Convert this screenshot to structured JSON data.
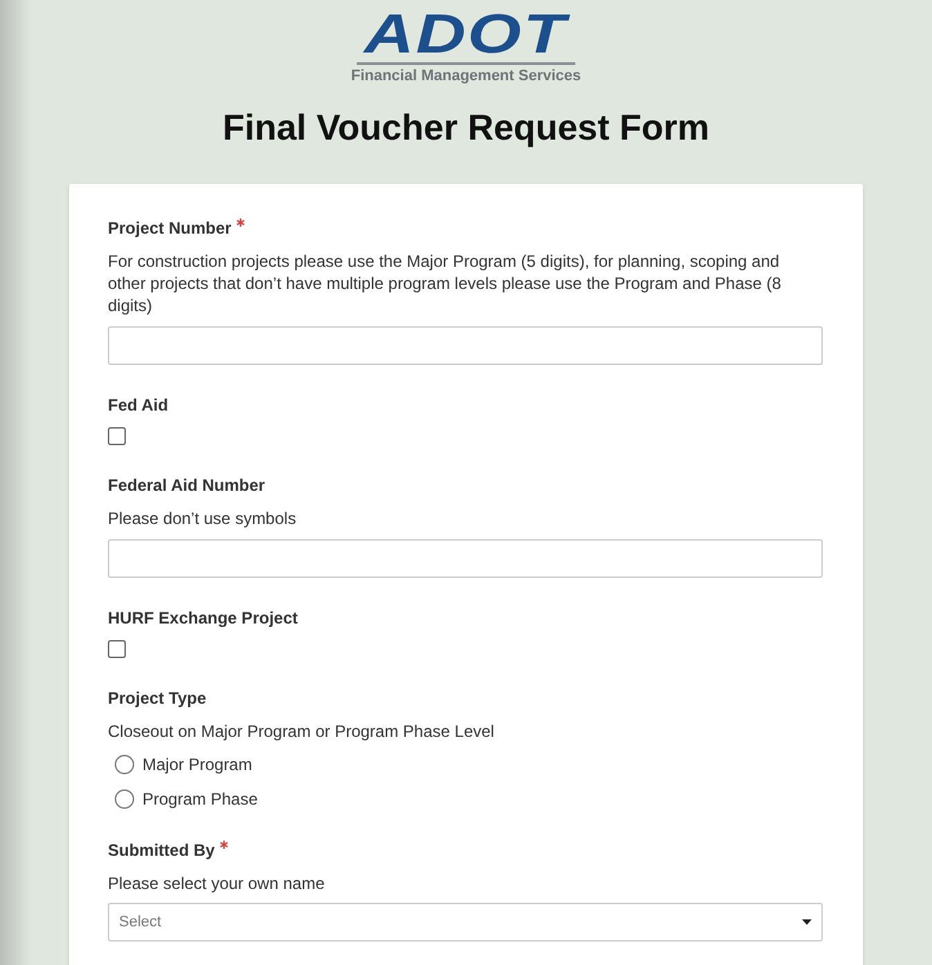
{
  "logo": {
    "wordmark": "ADOT",
    "subtitle": "Financial Management Services"
  },
  "title": "Final Voucher Request Form",
  "fields": [
    {
      "kind": "text",
      "label": "Project Number",
      "required": true,
      "description": "For construction projects please use the Major Program (5 digits), for planning, scoping and other projects that don’t have multiple program levels please use the Program and Phase (8 digits)"
    },
    {
      "kind": "checkbox",
      "label": "Fed Aid",
      "required": false,
      "checked": false
    },
    {
      "kind": "text",
      "label": "Federal Aid Number",
      "required": false,
      "description": "Please don’t use symbols"
    },
    {
      "kind": "checkbox",
      "label": "HURF Exchange Project",
      "required": false,
      "checked": false
    },
    {
      "kind": "radio",
      "label": "Project Type",
      "required": false,
      "description": "Closeout on Major Program or Program Phase Level",
      "options": [
        {
          "label": "Major Program",
          "selected": false
        },
        {
          "label": "Program Phase",
          "selected": false
        }
      ]
    },
    {
      "kind": "select",
      "label": "Submitted By",
      "required": true,
      "description": "Please select your own name",
      "placeholder": "Select"
    }
  ]
}
